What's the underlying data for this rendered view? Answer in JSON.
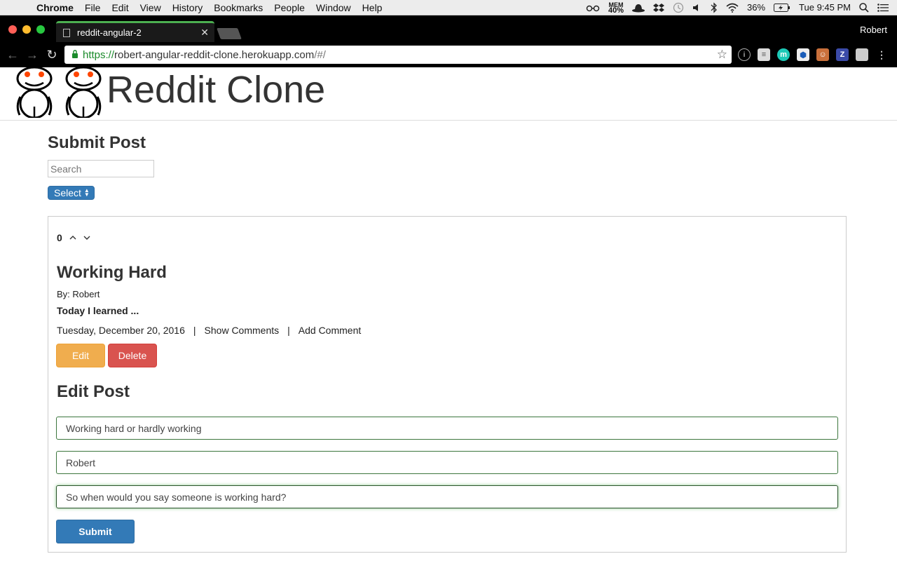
{
  "menubar": {
    "app": "Chrome",
    "items": [
      "File",
      "Edit",
      "View",
      "History",
      "Bookmarks",
      "People",
      "Window",
      "Help"
    ],
    "mem_label": "MEM",
    "mem_value": "40%",
    "battery": "36%",
    "clock": "Tue 9:45 PM"
  },
  "browser": {
    "tab_title": "reddit-angular-2",
    "profile": "Robert",
    "url_scheme": "https://",
    "url_host": "robert-angular-reddit-clone.herokuapp.com",
    "url_path": "/#/"
  },
  "site": {
    "title": "Reddit Clone"
  },
  "submit": {
    "heading": "Submit Post",
    "search_placeholder": "Search",
    "select_label": "Select"
  },
  "post": {
    "votes": "0",
    "title": "Working Hard",
    "author": "By: Robert",
    "body": "Today I learned ...",
    "date": "Tuesday, December 20, 2016",
    "show_comments": "Show Comments",
    "add_comment": "Add Comment",
    "edit_label": "Edit",
    "delete_label": "Delete"
  },
  "edit_form": {
    "heading": "Edit Post",
    "title_value": "Working hard or hardly working",
    "author_value": "Robert",
    "body_value": "So when would you say someone is working hard?",
    "submit_label": "Submit"
  },
  "colors": {
    "primary": "#337ab7",
    "warning": "#f0ad4e",
    "danger": "#d9534f",
    "success_border": "#3c763d",
    "tab_accent": "#4caf50"
  }
}
